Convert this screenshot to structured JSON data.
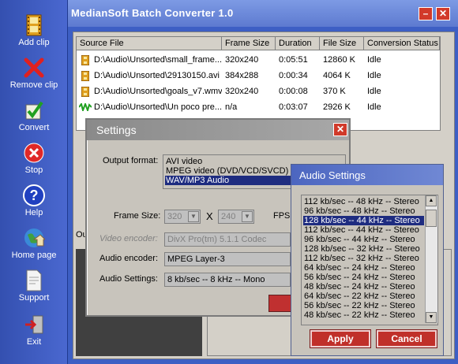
{
  "app": {
    "title": "MedianSoft Batch Converter 1.0",
    "minimize_glyph": "–",
    "close_glyph": "✕"
  },
  "sidebar": {
    "items": [
      {
        "label": "Add clip",
        "icon": "film-icon"
      },
      {
        "label": "Remove clip",
        "icon": "remove-x-icon"
      },
      {
        "label": "Convert",
        "icon": "checkmark-icon"
      },
      {
        "label": "Stop",
        "icon": "stop-icon"
      },
      {
        "label": "Help",
        "icon": "help-icon"
      },
      {
        "label": "Home page",
        "icon": "home-globe-icon"
      },
      {
        "label": "Support",
        "icon": "support-doc-icon"
      },
      {
        "label": "Exit",
        "icon": "exit-icon"
      }
    ]
  },
  "table": {
    "headers": [
      "Source File",
      "Frame Size",
      "Duration",
      "File Size",
      "Conversion Status"
    ],
    "rows": [
      {
        "file": "D:\\Audio\\Unsorted\\small_frame....",
        "frame": "320x240",
        "duration": "0:05:51",
        "size": "12860 K",
        "status": "Idle"
      },
      {
        "file": "D:\\Audio\\Unsorted\\29130150.avi",
        "frame": "384x288",
        "duration": "0:00:34",
        "size": "4064 K",
        "status": "Idle"
      },
      {
        "file": "D:\\Audio\\Unsorted\\goals_v7.wmv",
        "frame": "320x240",
        "duration": "0:00:08",
        "size": "370 K",
        "status": "Idle"
      },
      {
        "file": "D:\\Audio\\Unsorted\\Un poco pre...",
        "frame": "n/a",
        "duration": "0:03:07",
        "size": "2926 K",
        "status": "Idle"
      }
    ]
  },
  "background": {
    "output_label_fragment": "Out"
  },
  "settings": {
    "title": "Settings",
    "close_glyph": "✕",
    "output_format_label": "Output format:",
    "formats": [
      "AVI video",
      "MPEG video (DVD/VCD/SVCD)",
      "WAV/MP3 Audio"
    ],
    "selected_format": "WAV/MP3 Audio",
    "frame_size_label": "Frame Size:",
    "frame_width": "320",
    "frame_x": "X",
    "frame_height": "240",
    "fps_label": "FPS:",
    "video_encoder_label": "Video encoder:",
    "video_encoder_value": "DivX Pro(tm) 5.1.1 Codec",
    "audio_encoder_label": "Audio encoder:",
    "audio_encoder_value": "MPEG Layer-3",
    "audio_settings_label": "Audio Settings:",
    "audio_settings_value": "8 kb/sec -- 8 kHz -- Mono"
  },
  "audio_settings": {
    "title": "Audio Settings",
    "options": [
      "112 kb/sec -- 48 kHz -- Stereo",
      "96 kb/sec -- 48 kHz -- Stereo",
      "128 kb/sec -- 44 kHz -- Stereo",
      "112 kb/sec -- 44 kHz -- Stereo",
      "96 kb/sec -- 44 kHz -- Stereo",
      "128 kb/sec -- 32 kHz -- Stereo",
      "112 kb/sec -- 32 kHz -- Stereo",
      "64 kb/sec -- 24 kHz -- Stereo",
      "56 kb/sec -- 24 kHz -- Stereo",
      "48 kb/sec -- 24 kHz -- Stereo",
      "64 kb/sec -- 22 kHz -- Stereo",
      "56 kb/sec -- 22 kHz -- Stereo",
      "48 kb/sec -- 22 kHz -- Stereo"
    ],
    "selected": "128 kb/sec -- 44 kHz -- Stereo",
    "apply_label": "Apply",
    "cancel_label": "Cancel"
  },
  "colors": {
    "sidebar": "#3d5fc4",
    "selection": "#1e2c80",
    "button_red": "#c0302a"
  }
}
